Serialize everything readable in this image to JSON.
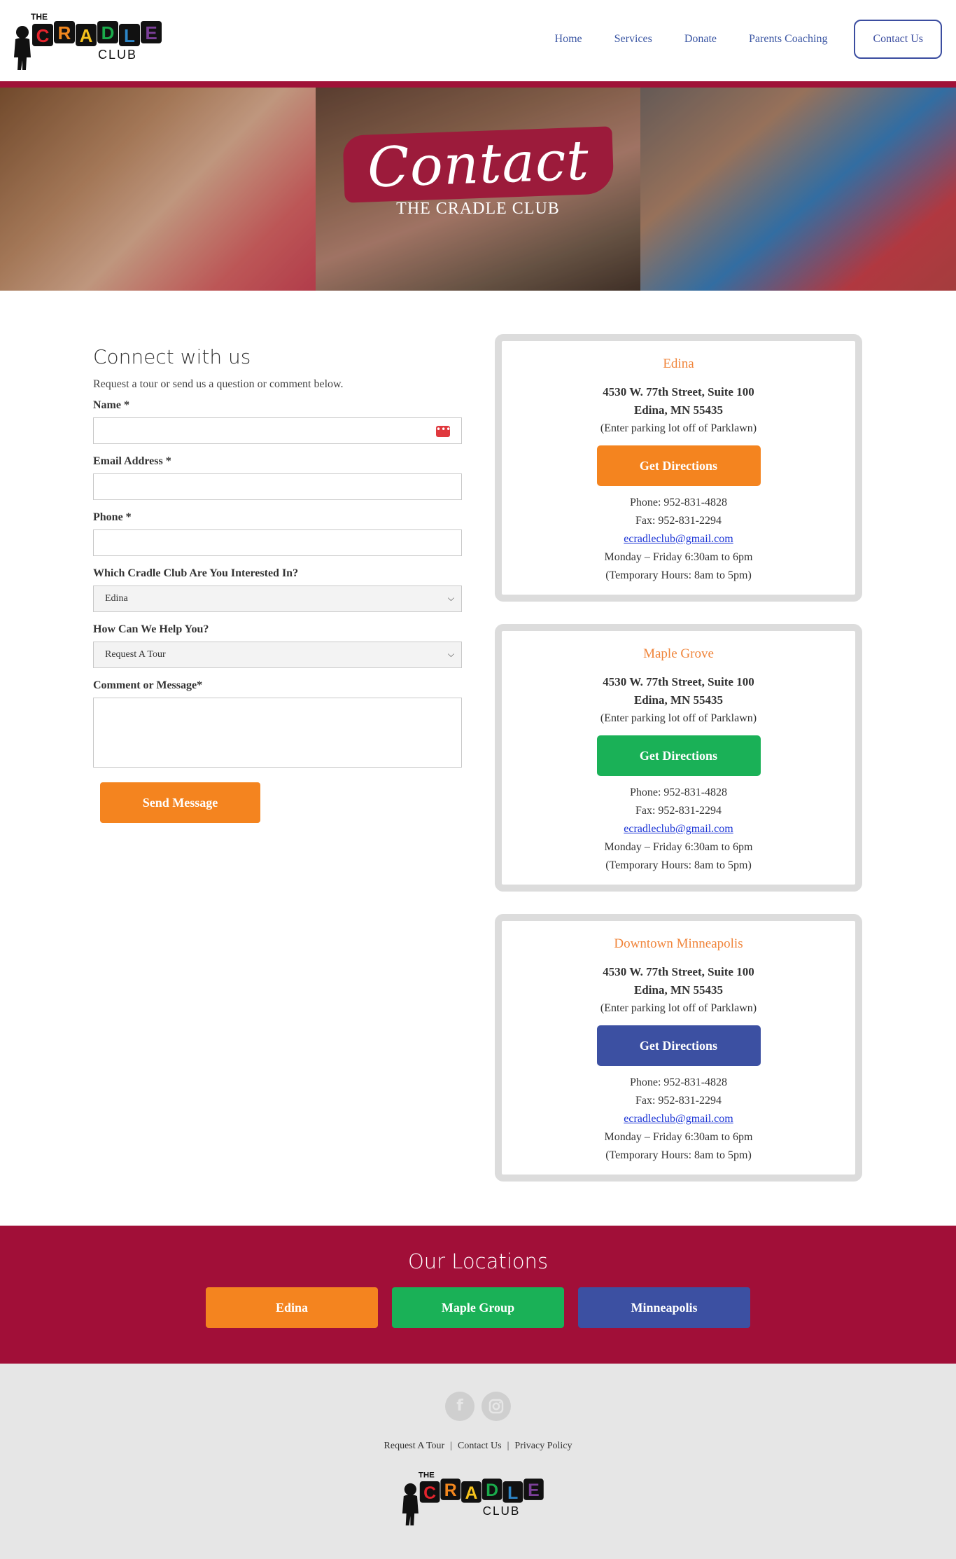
{
  "logo": {
    "top_text": "THE",
    "letters": [
      "C",
      "R",
      "A",
      "D",
      "L",
      "E"
    ],
    "bottom_text": "CLUB",
    "letter_colors": [
      "#e4242d",
      "#f2871e",
      "#f6c21c",
      "#1aab4b",
      "#2d86c8",
      "#7b3f98"
    ]
  },
  "nav": {
    "items": [
      "Home",
      "Services",
      "Donate",
      "Parents Coaching"
    ],
    "contact_label": "Contact Us"
  },
  "hero": {
    "title": "Contact",
    "subtitle": "THE CRADLE CLUB"
  },
  "form": {
    "heading": "Connect with us",
    "intro": "Request a tour or send us a question or comment below.",
    "name_label": "Name *",
    "email_label": "Email Address *",
    "phone_label": "Phone *",
    "club_label": "Which Cradle Club Are You Interested In?",
    "club_value": "Edina",
    "help_label": "How Can We Help You?",
    "help_value": "Request A Tour",
    "message_label": "Comment or Message*",
    "send_label": "Send Message"
  },
  "locations": [
    {
      "name": "Edina",
      "address1": "4530 W. 77th Street, Suite 100",
      "address2": "Edina, MN 55435",
      "note": "(Enter parking lot off of Parklawn)",
      "button": "Get Directions",
      "button_color": "#f4841f",
      "phone": "Phone: 952-831-4828",
      "fax": "Fax: 952-831-2294",
      "email": "ecradleclub@gmail.com",
      "hours": "Monday – Friday 6:30am to 6pm",
      "temp_hours": "(Temporary Hours: 8am to 5pm)"
    },
    {
      "name": "Maple Grove",
      "address1": "4530 W. 77th Street, Suite 100",
      "address2": "Edina, MN 55435",
      "note": "(Enter parking lot off of Parklawn)",
      "button": "Get Directions",
      "button_color": "#1ab157",
      "phone": "Phone: 952-831-4828",
      "fax": "Fax: 952-831-2294",
      "email": "ecradleclub@gmail.com",
      "hours": "Monday – Friday 6:30am to 6pm",
      "temp_hours": "(Temporary Hours: 8am to 5pm)"
    },
    {
      "name": "Downtown Minneapolis",
      "address1": "4530 W. 77th Street, Suite 100",
      "address2": "Edina, MN 55435",
      "note": "(Enter parking lot off of Parklawn)",
      "button": "Get Directions",
      "button_color": "#3c50a2",
      "phone": "Phone: 952-831-4828",
      "fax": "Fax: 952-831-2294",
      "email": "ecradleclub@gmail.com",
      "hours": "Monday – Friday 6:30am to 6pm",
      "temp_hours": "(Temporary Hours: 8am to 5pm)"
    }
  ],
  "our_locations": {
    "heading": "Our Locations",
    "buttons": [
      {
        "label": "Edina",
        "color": "#f4841f"
      },
      {
        "label": "Maple Group",
        "color": "#1ab157"
      },
      {
        "label": "Minneapolis",
        "color": "#3c50a2"
      }
    ]
  },
  "footer": {
    "social_icons": [
      "facebook-icon",
      "instagram-icon"
    ],
    "links": [
      "Request A Tour",
      "Contact Us",
      "Privacy Policy"
    ]
  },
  "colors": {
    "brand_red": "#a10f38",
    "accent_orange": "#f4841f",
    "nav_blue": "#3b56a3"
  }
}
